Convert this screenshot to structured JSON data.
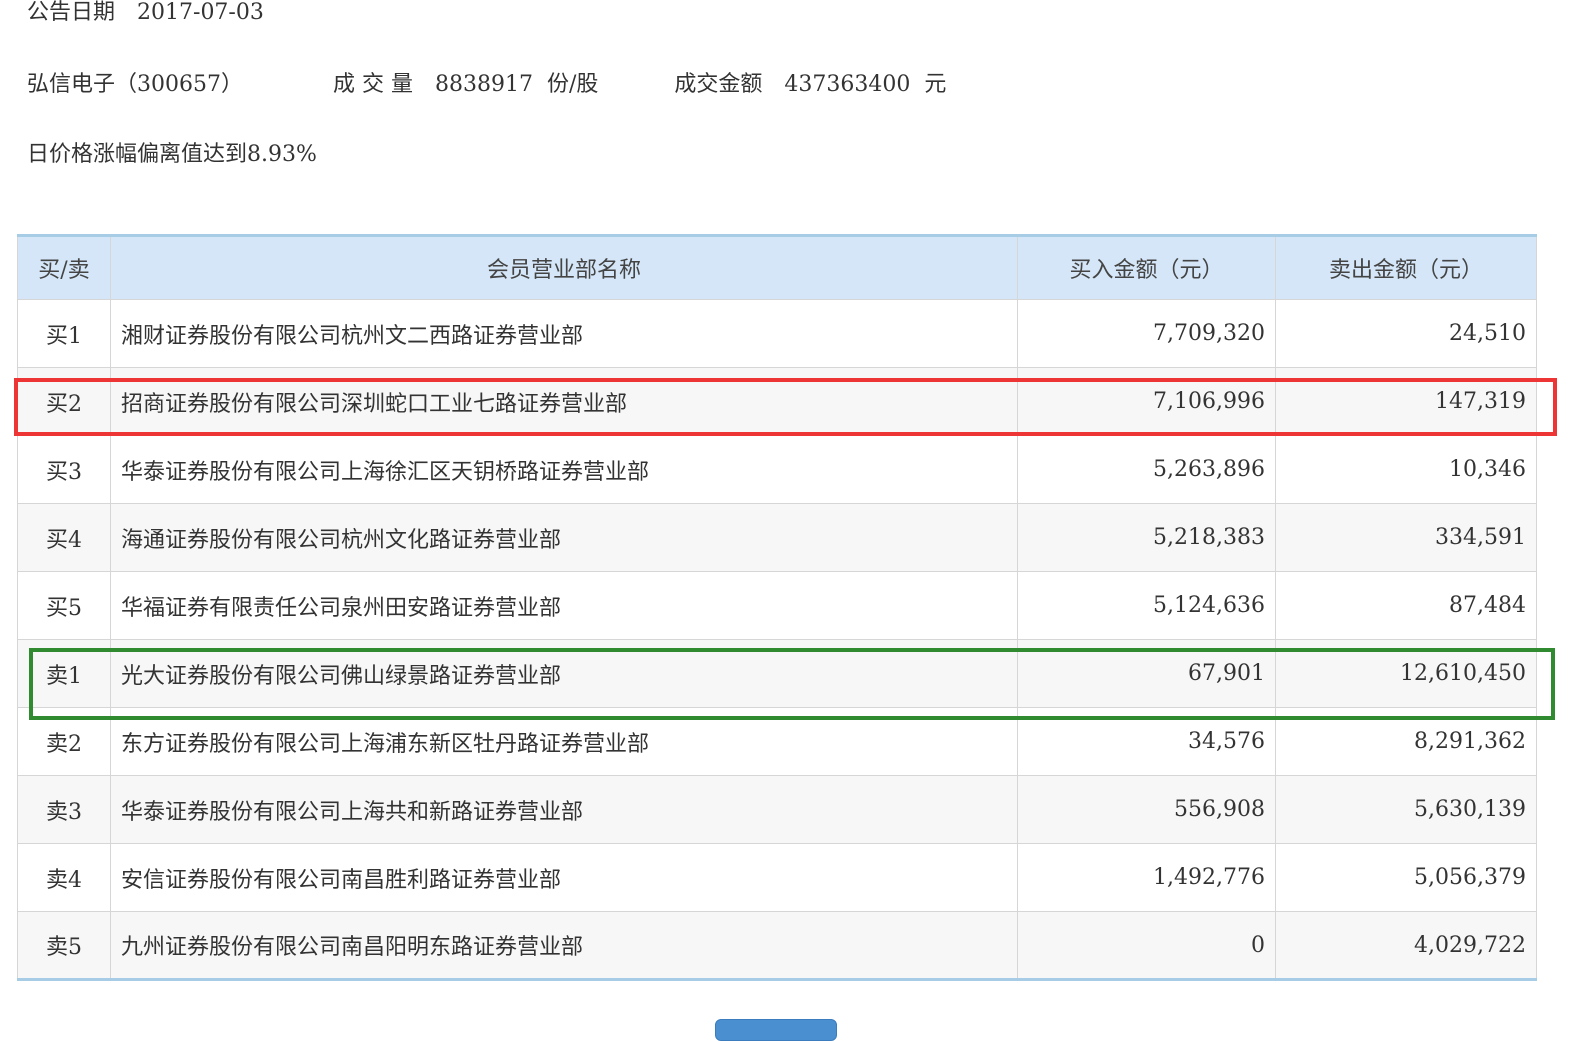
{
  "announcement": {
    "date_label": "公告日期",
    "date_value": "2017-07-03"
  },
  "stock": {
    "name_code": "弘信电子（300657）",
    "volume_label": "成 交 量",
    "volume_value": "8838917",
    "volume_unit": "份/股",
    "amount_label": "成交金额",
    "amount_value": "437363400",
    "amount_unit": "元"
  },
  "reason": "日价格涨幅偏离值达到8.93%",
  "table": {
    "headers": [
      "买/卖",
      "会员营业部名称",
      "买入金额（元）",
      "卖出金额（元）"
    ],
    "rows": [
      {
        "side": "买1",
        "name": "湘财证券股份有限公司杭州文二西路证券营业部",
        "buy": "7,709,320",
        "sell": "24,510"
      },
      {
        "side": "买2",
        "name": "招商证券股份有限公司深圳蛇口工业七路证券营业部",
        "buy": "7,106,996",
        "sell": "147,319"
      },
      {
        "side": "买3",
        "name": "华泰证券股份有限公司上海徐汇区天钥桥路证券营业部",
        "buy": "5,263,896",
        "sell": "10,346"
      },
      {
        "side": "买4",
        "name": "海通证券股份有限公司杭州文化路证券营业部",
        "buy": "5,218,383",
        "sell": "334,591"
      },
      {
        "side": "买5",
        "name": "华福证券有限责任公司泉州田安路证券营业部",
        "buy": "5,124,636",
        "sell": "87,484"
      },
      {
        "side": "卖1",
        "name": "光大证券股份有限公司佛山绿景路证券营业部",
        "buy": "67,901",
        "sell": "12,610,450"
      },
      {
        "side": "卖2",
        "name": "东方证券股份有限公司上海浦东新区牡丹路证券营业部",
        "buy": "34,576",
        "sell": "8,291,362"
      },
      {
        "side": "卖3",
        "name": "华泰证券股份有限公司上海共和新路证券营业部",
        "buy": "556,908",
        "sell": "5,630,139"
      },
      {
        "side": "卖4",
        "name": "安信证券股份有限公司南昌胜利路证券营业部",
        "buy": "1,492,776",
        "sell": "5,056,379"
      },
      {
        "side": "卖5",
        "name": "九州证券股份有限公司南昌阳明东路证券营业部",
        "buy": "0",
        "sell": "4,029,722"
      }
    ]
  },
  "highlights": {
    "red_color": "#ee3535",
    "green_color": "#2f8a30",
    "red_row": "买2",
    "green_row": "卖1"
  }
}
